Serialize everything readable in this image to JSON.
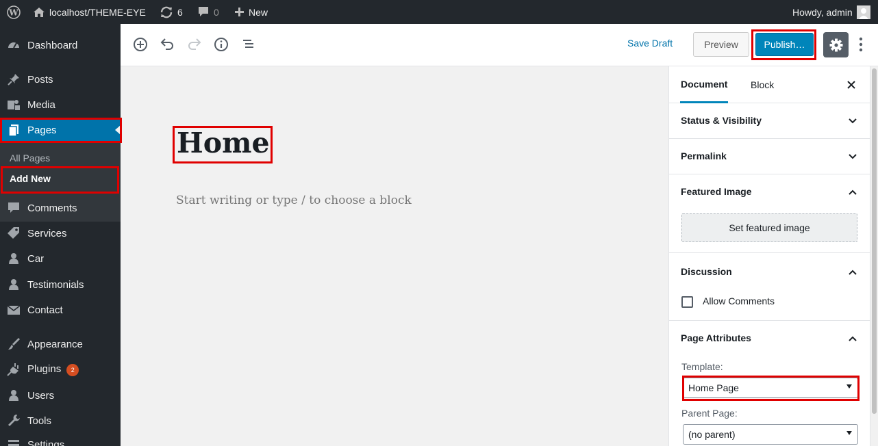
{
  "adminbar": {
    "site_name": "localhost/THEME-EYE",
    "updates_count": "6",
    "comments_count": "0",
    "new_label": "New",
    "greeting": "Howdy, admin"
  },
  "sidebar": {
    "items": [
      {
        "label": "Dashboard",
        "icon": "dashboard-icon"
      },
      {
        "label": "Posts",
        "icon": "pin-icon"
      },
      {
        "label": "Media",
        "icon": "media-icon"
      },
      {
        "label": "Pages",
        "icon": "pages-icon"
      },
      {
        "label": "Comments",
        "icon": "comment-icon"
      },
      {
        "label": "Services",
        "icon": "tag-icon"
      },
      {
        "label": "Car",
        "icon": "user-icon"
      },
      {
        "label": "Testimonials",
        "icon": "user-icon"
      },
      {
        "label": "Contact",
        "icon": "mail-icon"
      },
      {
        "label": "Appearance",
        "icon": "brush-icon"
      },
      {
        "label": "Plugins",
        "icon": "plugin-icon"
      },
      {
        "label": "Users",
        "icon": "user-icon"
      },
      {
        "label": "Tools",
        "icon": "wrench-icon"
      },
      {
        "label": "Settings",
        "icon": "settings-icon"
      }
    ],
    "plugins_badge": "2",
    "submenu": {
      "all_pages": "All Pages",
      "add_new": "Add New"
    }
  },
  "header": {
    "save_draft": "Save Draft",
    "preview": "Preview",
    "publish": "Publish…"
  },
  "editor": {
    "title": "Home",
    "placeholder": "Start writing or type / to choose a block"
  },
  "panel": {
    "tabs": {
      "document": "Document",
      "block": "Block"
    },
    "sections": {
      "status": "Status & Visibility",
      "permalink": "Permalink",
      "featured": "Featured Image",
      "discussion": "Discussion",
      "attributes": "Page Attributes"
    },
    "set_featured": "Set featured image",
    "allow_comments": "Allow Comments",
    "template_label": "Template:",
    "template_value": "Home Page",
    "parent_label": "Parent Page:",
    "parent_value": "(no parent)"
  },
  "colors": {
    "accent": "#0073aa",
    "publish": "#0085ba",
    "highlight": "#e00000",
    "adminbar": "#23282d"
  }
}
